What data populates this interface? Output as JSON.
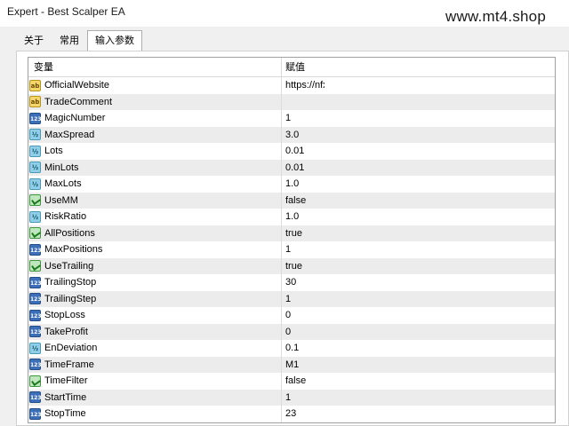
{
  "window": {
    "title": "Expert - Best Scalper EA",
    "watermark": "www.mt4.shop"
  },
  "tabs": [
    {
      "label": "关于"
    },
    {
      "label": "常用"
    },
    {
      "label": "输入参数"
    }
  ],
  "grid": {
    "col_variable": "变量",
    "col_value": "赋值",
    "rows": [
      {
        "name": "OfficialWebsite",
        "value": "https://nfx",
        "type": "str"
      },
      {
        "name": "TradeComment",
        "value": "",
        "type": "str"
      },
      {
        "name": "MagicNumber",
        "value": "1",
        "type": "int"
      },
      {
        "name": "MaxSpread",
        "value": "3.0",
        "type": "dbl"
      },
      {
        "name": "Lots",
        "value": "0.01",
        "type": "dbl"
      },
      {
        "name": "MinLots",
        "value": "0.01",
        "type": "dbl"
      },
      {
        "name": "MaxLots",
        "value": "1.0",
        "type": "dbl"
      },
      {
        "name": "UseMM",
        "value": "false",
        "type": "bool"
      },
      {
        "name": "RiskRatio",
        "value": "1.0",
        "type": "dbl"
      },
      {
        "name": "AllPositions",
        "value": "true",
        "type": "bool"
      },
      {
        "name": "MaxPositions",
        "value": "1",
        "type": "int"
      },
      {
        "name": "UseTrailing",
        "value": "true",
        "type": "bool"
      },
      {
        "name": "TrailingStop",
        "value": "30",
        "type": "int"
      },
      {
        "name": "TrailingStep",
        "value": "1",
        "type": "int"
      },
      {
        "name": "StopLoss",
        "value": "0",
        "type": "int"
      },
      {
        "name": "TakeProfit",
        "value": "0",
        "type": "int"
      },
      {
        "name": "EnDeviation",
        "value": "0.1",
        "type": "dbl"
      },
      {
        "name": "TimeFrame",
        "value": "M1",
        "type": "enum"
      },
      {
        "name": "TimeFilter",
        "value": "false",
        "type": "bool"
      },
      {
        "name": "StartTime",
        "value": "1",
        "type": "int"
      },
      {
        "name": "StopTime",
        "value": "23",
        "type": "int"
      }
    ]
  },
  "icons": {
    "str": "string-type-icon",
    "int": "integer-type-icon",
    "dbl": "double-type-icon",
    "bool": "boolean-type-icon",
    "enum": "enum-type-icon"
  },
  "icon_glyphs": {
    "str": "ab",
    "int": "123",
    "dbl": "½",
    "bool": "",
    "enum": "123"
  }
}
